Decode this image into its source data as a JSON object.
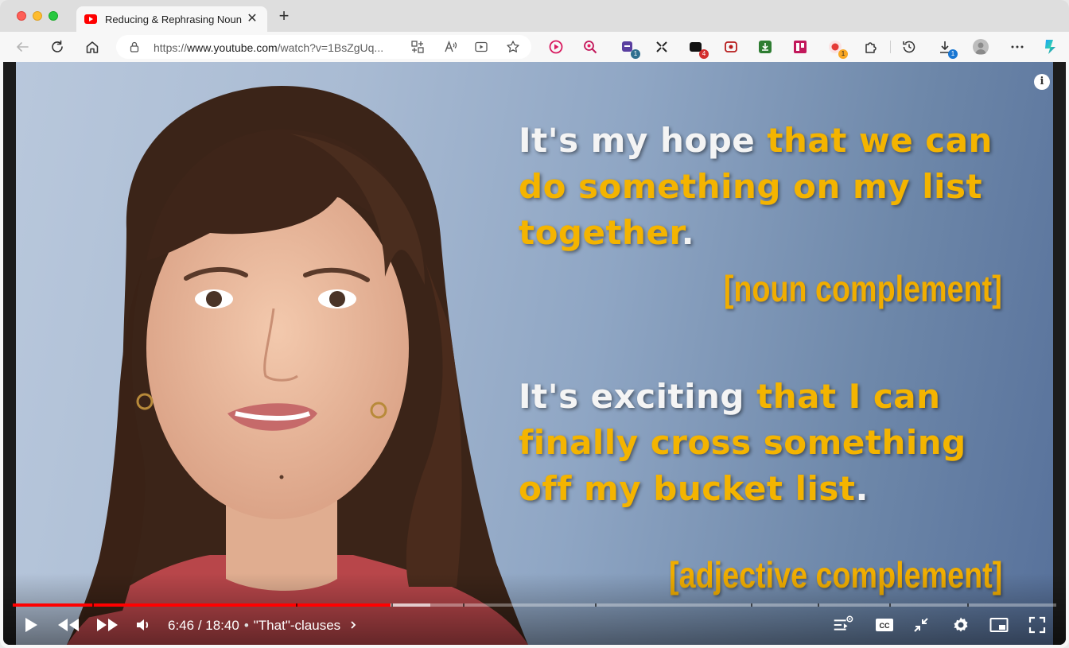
{
  "browser": {
    "tab": {
      "title": "Reducing & Rephrasing Noun Clauses"
    },
    "address": {
      "scheme": "https://",
      "host": "www.youtube.com",
      "path": "/watch?v=1BsZgUq..."
    },
    "extensions": [
      {
        "name": "video-ext-icon",
        "color": "#d81b60"
      },
      {
        "name": "magnify-ext-icon",
        "color": "#c2185b"
      },
      {
        "name": "puzzle-ext-icon",
        "color": "#5a3fa0",
        "badge": "1",
        "badge_color": "#2f6f8f"
      },
      {
        "name": "expand-ext-icon",
        "color": "#222222"
      },
      {
        "name": "dark-ext-icon",
        "color": "#111111",
        "badge": "4",
        "badge_color": "#d32f2f"
      },
      {
        "name": "record-ext-icon",
        "color": "#b71c1c"
      },
      {
        "name": "download-ext-icon",
        "color": "#2e7d32"
      },
      {
        "name": "board-ext-icon",
        "color": "#c2185b"
      },
      {
        "name": "rec-ext-icon",
        "color": "#e53935",
        "badge": "1",
        "badge_color": "#f9a825"
      }
    ],
    "download_badge": "1"
  },
  "video": {
    "captions": {
      "sentence1": {
        "white": "It's my hope ",
        "yellow": "that we can do something on my list together",
        "end": "."
      },
      "label1": "[noun complement]",
      "sentence2": {
        "white": "It's exciting ",
        "yellow": "that I can finally cross something off my bucket list",
        "end": "."
      },
      "label2": "[adjective complement]"
    },
    "player": {
      "current_time": "6:46",
      "duration": "18:40",
      "chapter": "\"That\"-clauses",
      "progress_fraction": 0.362,
      "buffer_fraction": 0.4
    }
  },
  "colors": {
    "highlight": "#f4b400",
    "progress": "#ff0000"
  }
}
